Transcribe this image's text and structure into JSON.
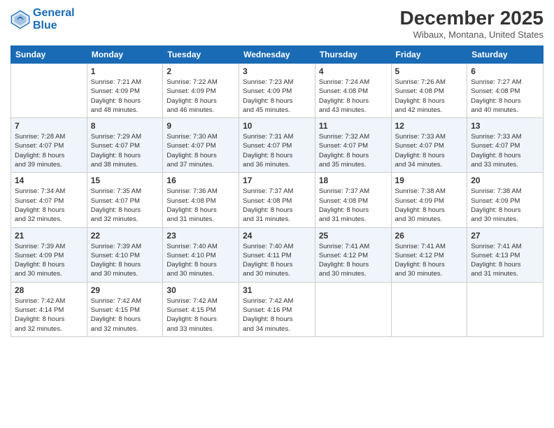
{
  "logo": {
    "line1": "General",
    "line2": "Blue"
  },
  "title": "December 2025",
  "location": "Wibaux, Montana, United States",
  "weekdays": [
    "Sunday",
    "Monday",
    "Tuesday",
    "Wednesday",
    "Thursday",
    "Friday",
    "Saturday"
  ],
  "weeks": [
    [
      {
        "day": "",
        "info": ""
      },
      {
        "day": "1",
        "info": "Sunrise: 7:21 AM\nSunset: 4:09 PM\nDaylight: 8 hours\nand 48 minutes."
      },
      {
        "day": "2",
        "info": "Sunrise: 7:22 AM\nSunset: 4:09 PM\nDaylight: 8 hours\nand 46 minutes."
      },
      {
        "day": "3",
        "info": "Sunrise: 7:23 AM\nSunset: 4:09 PM\nDaylight: 8 hours\nand 45 minutes."
      },
      {
        "day": "4",
        "info": "Sunrise: 7:24 AM\nSunset: 4:08 PM\nDaylight: 8 hours\nand 43 minutes."
      },
      {
        "day": "5",
        "info": "Sunrise: 7:26 AM\nSunset: 4:08 PM\nDaylight: 8 hours\nand 42 minutes."
      },
      {
        "day": "6",
        "info": "Sunrise: 7:27 AM\nSunset: 4:08 PM\nDaylight: 8 hours\nand 40 minutes."
      }
    ],
    [
      {
        "day": "7",
        "info": "Sunrise: 7:28 AM\nSunset: 4:07 PM\nDaylight: 8 hours\nand 39 minutes."
      },
      {
        "day": "8",
        "info": "Sunrise: 7:29 AM\nSunset: 4:07 PM\nDaylight: 8 hours\nand 38 minutes."
      },
      {
        "day": "9",
        "info": "Sunrise: 7:30 AM\nSunset: 4:07 PM\nDaylight: 8 hours\nand 37 minutes."
      },
      {
        "day": "10",
        "info": "Sunrise: 7:31 AM\nSunset: 4:07 PM\nDaylight: 8 hours\nand 36 minutes."
      },
      {
        "day": "11",
        "info": "Sunrise: 7:32 AM\nSunset: 4:07 PM\nDaylight: 8 hours\nand 35 minutes."
      },
      {
        "day": "12",
        "info": "Sunrise: 7:33 AM\nSunset: 4:07 PM\nDaylight: 8 hours\nand 34 minutes."
      },
      {
        "day": "13",
        "info": "Sunrise: 7:33 AM\nSunset: 4:07 PM\nDaylight: 8 hours\nand 33 minutes."
      }
    ],
    [
      {
        "day": "14",
        "info": "Sunrise: 7:34 AM\nSunset: 4:07 PM\nDaylight: 8 hours\nand 32 minutes."
      },
      {
        "day": "15",
        "info": "Sunrise: 7:35 AM\nSunset: 4:07 PM\nDaylight: 8 hours\nand 32 minutes."
      },
      {
        "day": "16",
        "info": "Sunrise: 7:36 AM\nSunset: 4:08 PM\nDaylight: 8 hours\nand 31 minutes."
      },
      {
        "day": "17",
        "info": "Sunrise: 7:37 AM\nSunset: 4:08 PM\nDaylight: 8 hours\nand 31 minutes."
      },
      {
        "day": "18",
        "info": "Sunrise: 7:37 AM\nSunset: 4:08 PM\nDaylight: 8 hours\nand 31 minutes."
      },
      {
        "day": "19",
        "info": "Sunrise: 7:38 AM\nSunset: 4:09 PM\nDaylight: 8 hours\nand 30 minutes."
      },
      {
        "day": "20",
        "info": "Sunrise: 7:38 AM\nSunset: 4:09 PM\nDaylight: 8 hours\nand 30 minutes."
      }
    ],
    [
      {
        "day": "21",
        "info": "Sunrise: 7:39 AM\nSunset: 4:09 PM\nDaylight: 8 hours\nand 30 minutes."
      },
      {
        "day": "22",
        "info": "Sunrise: 7:39 AM\nSunset: 4:10 PM\nDaylight: 8 hours\nand 30 minutes."
      },
      {
        "day": "23",
        "info": "Sunrise: 7:40 AM\nSunset: 4:10 PM\nDaylight: 8 hours\nand 30 minutes."
      },
      {
        "day": "24",
        "info": "Sunrise: 7:40 AM\nSunset: 4:11 PM\nDaylight: 8 hours\nand 30 minutes."
      },
      {
        "day": "25",
        "info": "Sunrise: 7:41 AM\nSunset: 4:12 PM\nDaylight: 8 hours\nand 30 minutes."
      },
      {
        "day": "26",
        "info": "Sunrise: 7:41 AM\nSunset: 4:12 PM\nDaylight: 8 hours\nand 30 minutes."
      },
      {
        "day": "27",
        "info": "Sunrise: 7:41 AM\nSunset: 4:13 PM\nDaylight: 8 hours\nand 31 minutes."
      }
    ],
    [
      {
        "day": "28",
        "info": "Sunrise: 7:42 AM\nSunset: 4:14 PM\nDaylight: 8 hours\nand 32 minutes."
      },
      {
        "day": "29",
        "info": "Sunrise: 7:42 AM\nSunset: 4:15 PM\nDaylight: 8 hours\nand 32 minutes."
      },
      {
        "day": "30",
        "info": "Sunrise: 7:42 AM\nSunset: 4:15 PM\nDaylight: 8 hours\nand 33 minutes."
      },
      {
        "day": "31",
        "info": "Sunrise: 7:42 AM\nSunset: 4:16 PM\nDaylight: 8 hours\nand 34 minutes."
      },
      {
        "day": "",
        "info": ""
      },
      {
        "day": "",
        "info": ""
      },
      {
        "day": "",
        "info": ""
      }
    ]
  ]
}
